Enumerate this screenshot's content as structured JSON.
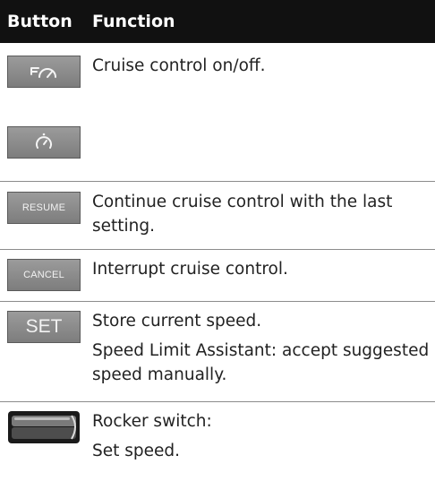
{
  "header": {
    "col1": "Button",
    "col2": "Function"
  },
  "rows": [
    {
      "buttons": [
        {
          "type": "icon",
          "icon": "cruise-control-icon"
        },
        {
          "type": "icon",
          "icon": "speedometer-icon"
        }
      ],
      "lines": [
        "Cruise control on/off."
      ]
    },
    {
      "buttons": [
        {
          "type": "label",
          "label": "RESUME"
        }
      ],
      "lines": [
        "Continue cruise control with the last setting."
      ]
    },
    {
      "buttons": [
        {
          "type": "label",
          "label": "CANCEL"
        }
      ],
      "lines": [
        "Interrupt cruise control."
      ]
    },
    {
      "buttons": [
        {
          "type": "label",
          "label": "SET"
        }
      ],
      "lines": [
        "Store current speed.",
        "Speed Limit Assistant: accept suggested speed manually."
      ]
    },
    {
      "buttons": [
        {
          "type": "icon",
          "icon": "rocker-switch-icon"
        }
      ],
      "lines": [
        "Rocker switch:",
        "Set speed."
      ]
    }
  ]
}
